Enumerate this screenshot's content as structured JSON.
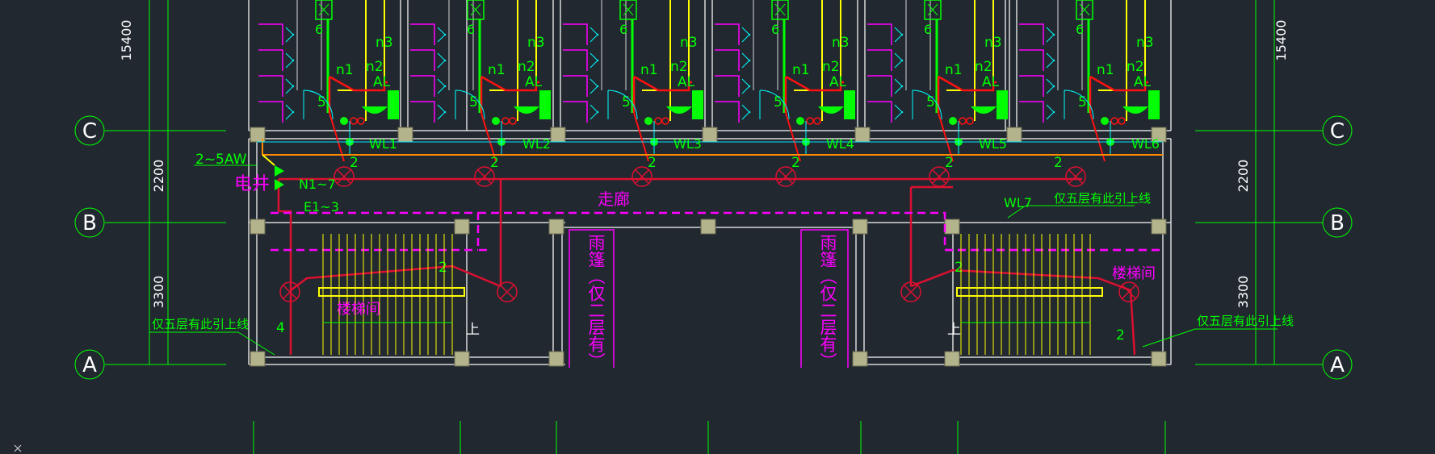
{
  "drawing": {
    "background_color": "#212830",
    "grid_axes": [
      {
        "label": "C"
      },
      {
        "label": "B"
      },
      {
        "label": "A"
      }
    ],
    "dimensions": {
      "top": "15400",
      "middle": "2200",
      "bottom": "3300"
    },
    "feeder_label": "2~5AW",
    "shaft_label": "电井",
    "outlet_labels": [
      "N1~7",
      "E1~3"
    ],
    "circuits": [
      "WL1",
      "WL2",
      "WL3",
      "WL4",
      "WL5",
      "WL6",
      "WL7"
    ],
    "fixture_counts": [
      "2",
      "2",
      "2",
      "2",
      "2",
      "2",
      "2",
      "2",
      "4",
      "2"
    ],
    "room_labels": {
      "n1": "n1",
      "n2": "n2",
      "n3": "n3",
      "al": "AL",
      "six": "6",
      "five": "5"
    },
    "corridor": "走廊",
    "stair_left": "楼梯间",
    "stair_right": "楼梯间",
    "canopy_left": "雨篷（仅二层有）",
    "canopy_right": "雨篷（仅二层有）",
    "note_upper_right": "仅五层有此引上线",
    "note_left": "仅五层有此引上线",
    "note_right": "仅五层有此引上线",
    "up_label": "上",
    "colors": {
      "green": "#00ff00",
      "red": "#ff1010",
      "yellow": "#ffff00",
      "magenta": "#ff00ff",
      "cyan": "#00ffff",
      "orange": "#ff8c00",
      "white": "#ffffff",
      "gray_column": "#b4b48c"
    }
  }
}
